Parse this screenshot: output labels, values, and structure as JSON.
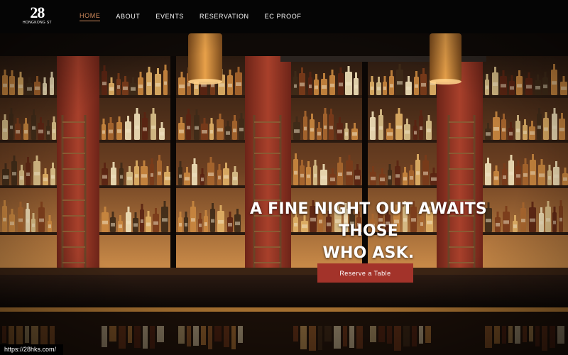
{
  "brand": {
    "number": "28",
    "subtitle": "HONGKONG ST"
  },
  "nav": {
    "items": [
      "HOME",
      "ABOUT",
      "EVENTS",
      "RESERVATION",
      "EC PROOF"
    ],
    "active_index": 0
  },
  "hero": {
    "headline_line1": "A FINE NIGHT OUT AWAITS THOSE",
    "headline_line2": "WHO ASK.",
    "cta_label": "Reserve a Table",
    "background_image": "bar-shelves-photo"
  },
  "status_url": "https://28hks.com/",
  "colors": {
    "nav_bg": "#050505",
    "active": "#d08a5c",
    "cta_bg": "#a3332a",
    "red_pillar": "#9c3524",
    "shelf_glow": "#e0a35c"
  }
}
